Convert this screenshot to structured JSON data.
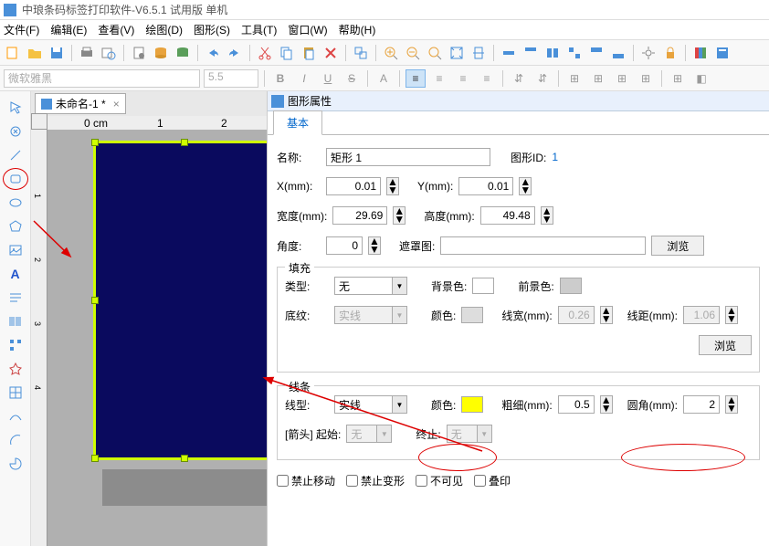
{
  "titlebar": {
    "text": "中琅条码标签打印软件-V6.5.1 试用版 单机"
  },
  "menu": {
    "items": [
      "文件(F)",
      "编辑(E)",
      "查看(V)",
      "绘图(D)",
      "图形(S)",
      "工具(T)",
      "窗口(W)",
      "帮助(H)"
    ]
  },
  "toolbar2": {
    "font": "微软雅黑",
    "size": "5.5"
  },
  "document": {
    "tab_name": "未命名-1 *",
    "close": "×"
  },
  "ruler": {
    "marks_h": [
      "0 cm",
      "1",
      "2"
    ],
    "marks_v": [
      "1",
      "2",
      "3",
      "4"
    ]
  },
  "panel": {
    "title": "图形属性",
    "tab": "基本",
    "name_label": "名称:",
    "name_value": "矩形 1",
    "id_label": "图形ID:",
    "id_value": "1",
    "x_label": "X(mm):",
    "x_value": "0.01",
    "y_label": "Y(mm):",
    "y_value": "0.01",
    "width_label": "宽度(mm):",
    "width_value": "29.69",
    "height_label": "高度(mm):",
    "height_value": "49.48",
    "angle_label": "角度:",
    "angle_value": "0",
    "mask_label": "遮罩图:",
    "mask_value": "",
    "browse": "浏览",
    "fill": {
      "title": "填充",
      "type_label": "类型:",
      "type_value": "无",
      "bgcolor_label": "背景色:",
      "fgcolor_label": "前景色:",
      "pattern_label": "底纹:",
      "pattern_value": "实线",
      "color_label": "颜色:",
      "linewidth_label": "线宽(mm):",
      "linewidth_value": "0.26",
      "linegap_label": "线距(mm):",
      "linegap_value": "1.06",
      "browse": "浏览"
    },
    "line": {
      "title": "线条",
      "type_label": "线型:",
      "type_value": "实线",
      "color_label": "颜色:",
      "thickness_label": "粗细(mm):",
      "thickness_value": "0.5",
      "corner_label": "圆角(mm):",
      "corner_value": "2",
      "arrow_label": "[箭头]  起始:",
      "arrow_start": "无",
      "end_label": "终止:",
      "arrow_end": "无"
    },
    "checkboxes": {
      "lock_move": "禁止移动",
      "lock_transform": "禁止变形",
      "invisible": "不可见",
      "overprint": "叠印"
    }
  }
}
